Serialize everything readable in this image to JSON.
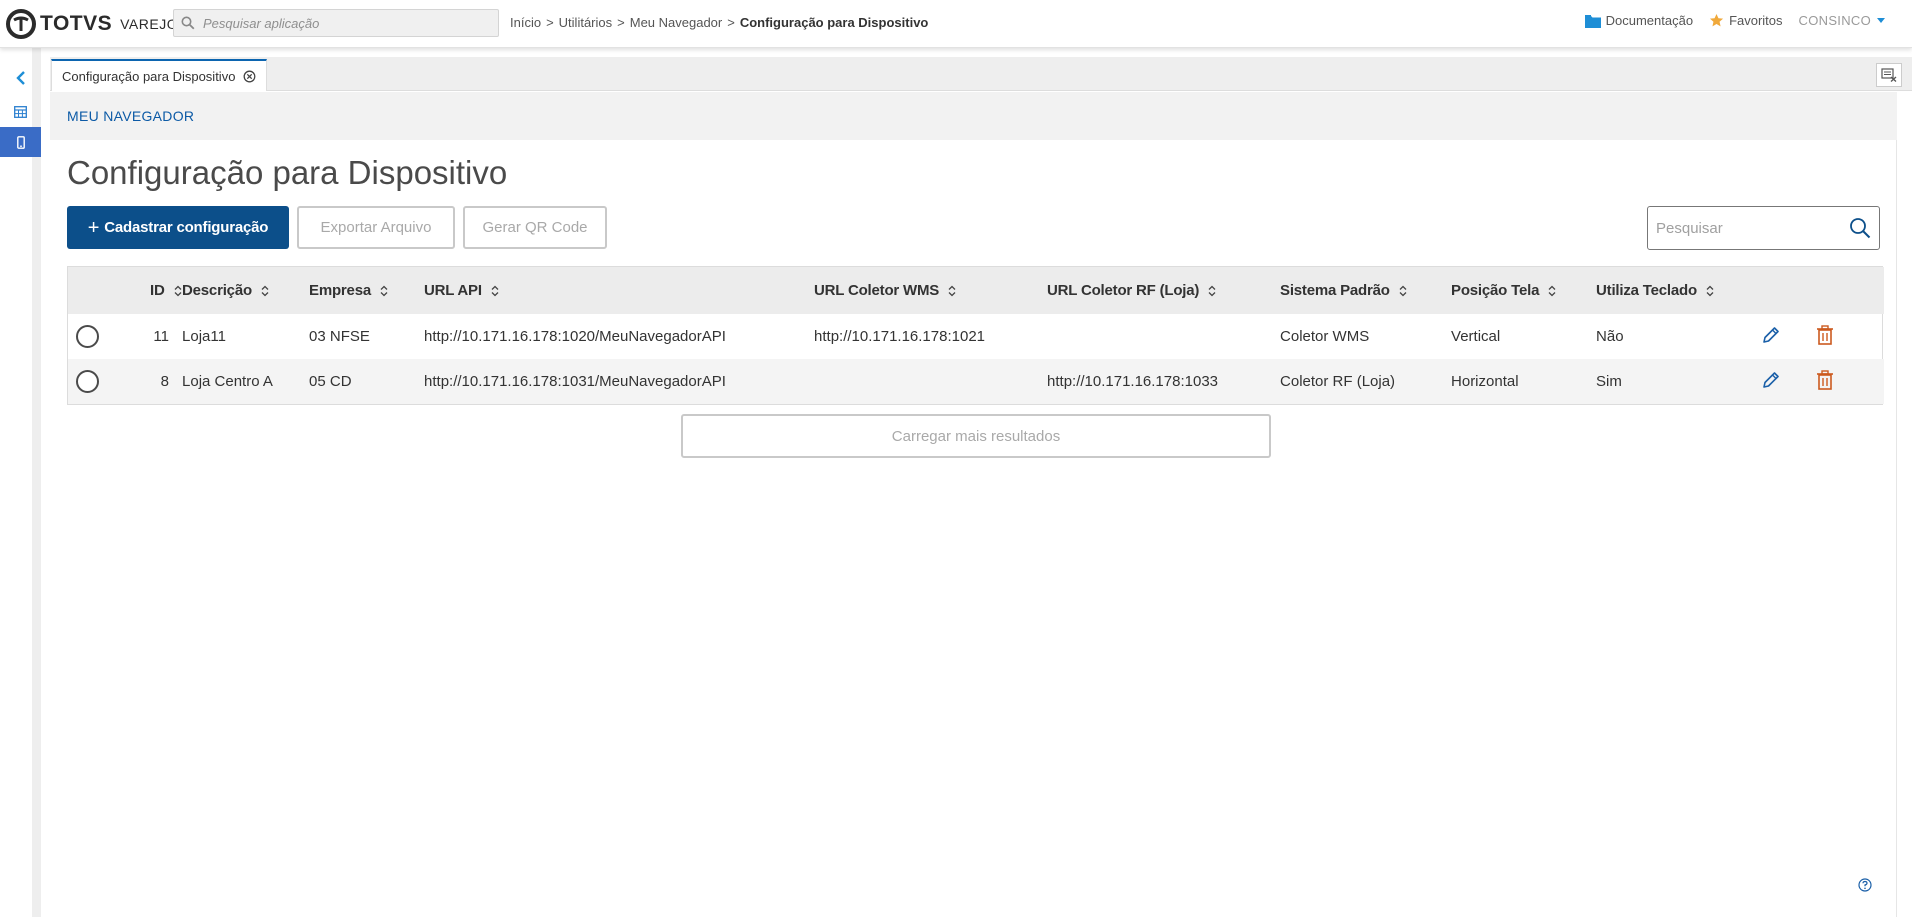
{
  "brand": {
    "name": "TOTVS",
    "product": "VAREJO",
    "accent": "#0c4f8a",
    "selected": "#3a6cc6"
  },
  "topbar": {
    "search_placeholder": "Pesquisar aplicação",
    "breadcrumb": [
      "Início",
      "Utilitários",
      "Meu Navegador",
      "Configuração para Dispositivo"
    ],
    "docs_label": "Documentação",
    "favorites_label": "Favoritos",
    "user_label": "CONSINCO"
  },
  "sidebar": {
    "items": [
      {
        "icon": "chevron-left-icon"
      },
      {
        "icon": "grid-icon"
      },
      {
        "icon": "mobile-device-icon",
        "active": true
      }
    ]
  },
  "tabs": [
    {
      "label": "Configuração para Dispositivo",
      "active": true
    }
  ],
  "page": {
    "section": "MEU NAVEGADOR",
    "title": "Configuração para Dispositivo",
    "buttons": {
      "add": "Cadastrar configuração",
      "export": "Exportar Arquivo",
      "qr": "Gerar QR Code",
      "load_more": "Carregar mais resultados"
    },
    "search_placeholder": "Pesquisar"
  },
  "table": {
    "columns": [
      "ID",
      "Descrição",
      "Empresa",
      "URL API",
      "URL Coletor WMS",
      "URL Coletor RF (Loja)",
      "Sistema Padrão",
      "Posição Tela",
      "Utiliza Teclado"
    ],
    "rows": [
      {
        "id": "11",
        "descricao": "Loja11",
        "empresa": "03 NFSE",
        "url_api": "http://10.171.16.178:1020/MeuNavegadorAPI",
        "url_wms": "http://10.171.16.178:1021",
        "url_rf": "",
        "sistema": "Coletor WMS",
        "posicao": "Vertical",
        "teclado": "Não"
      },
      {
        "id": "8",
        "descricao": "Loja Centro A",
        "empresa": "05 CD",
        "url_api": "http://10.171.16.178:1031/MeuNavegadorAPI",
        "url_wms": "",
        "url_rf": "http://10.171.16.178:1033",
        "sistema": "Coletor RF (Loja)",
        "posicao": "Horizontal",
        "teclado": "Sim"
      }
    ]
  }
}
